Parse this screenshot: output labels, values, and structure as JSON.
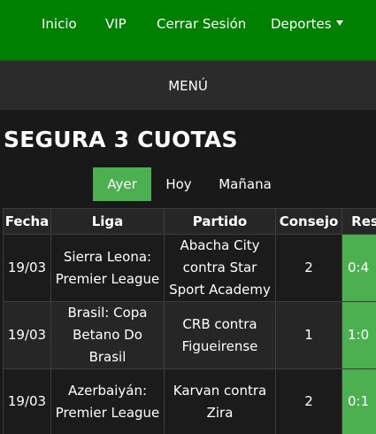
{
  "topnav": {
    "items": [
      "Inicio",
      "VIP",
      "Cerrar Sesión",
      "Deportes"
    ]
  },
  "menu": {
    "label": "MENÚ"
  },
  "page": {
    "title": "SEGURA 3 CUOTAS"
  },
  "tabs": [
    {
      "label": "Ayer",
      "active": true
    },
    {
      "label": "Hoy",
      "active": false
    },
    {
      "label": "Mañana",
      "active": false
    }
  ],
  "table": {
    "headers": [
      "Fecha",
      "Liga",
      "Partido",
      "Consejo",
      "Res"
    ],
    "rows": [
      {
        "fecha": "19/03",
        "liga": "Sierra Leona: Premier League",
        "partido": "Abacha City contra Star Sport Academy",
        "consejo": "2",
        "res": "0:4"
      },
      {
        "fecha": "19/03",
        "liga": "Brasil: Copa Betano Do Brasil",
        "partido": "CRB contra Figueirense",
        "consejo": "1",
        "res": "1:0"
      },
      {
        "fecha": "19/03",
        "liga": "Azerbaiyán: Premier League",
        "partido": "Karvan contra Zira",
        "consejo": "2",
        "res": "0:1"
      }
    ]
  },
  "colors": {
    "nav_green": "#008000",
    "active_green": "#4caf50",
    "background": "#1f1f1f"
  },
  "icons": {
    "deportes_dropdown": "caret-down-icon"
  }
}
